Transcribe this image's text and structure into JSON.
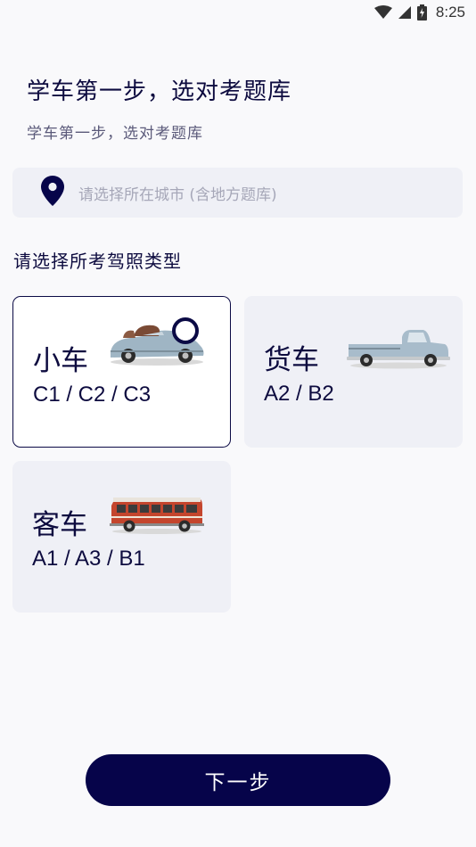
{
  "status_bar": {
    "time": "8:25",
    "icons": [
      "wifi-icon",
      "signal-icon",
      "battery-charging-icon"
    ]
  },
  "header": {
    "title": "学车第一步，选对考题库",
    "subtitle": "学车第一步，选对考题库"
  },
  "city": {
    "icon": "location-pin-icon",
    "placeholder": "请选择所在城市 (含地方题库)"
  },
  "license_section": {
    "label": "请选择所考驾照类型",
    "options": [
      {
        "name": "小车",
        "codes": "C1 / C2 / C3",
        "selected": true,
        "icon": "convertible-car-icon"
      },
      {
        "name": "货车",
        "codes": "A2 / B2",
        "selected": false,
        "icon": "pickup-truck-icon"
      },
      {
        "name": "客车",
        "codes": "A1 / A3 / B1",
        "selected": false,
        "icon": "bus-icon"
      }
    ]
  },
  "footer": {
    "next_label": "下一步"
  },
  "colors": {
    "primary": "#06044a",
    "card_bg": "#eff0f6",
    "page_bg": "#f9f9fb",
    "muted_text": "#a6a7b8"
  }
}
